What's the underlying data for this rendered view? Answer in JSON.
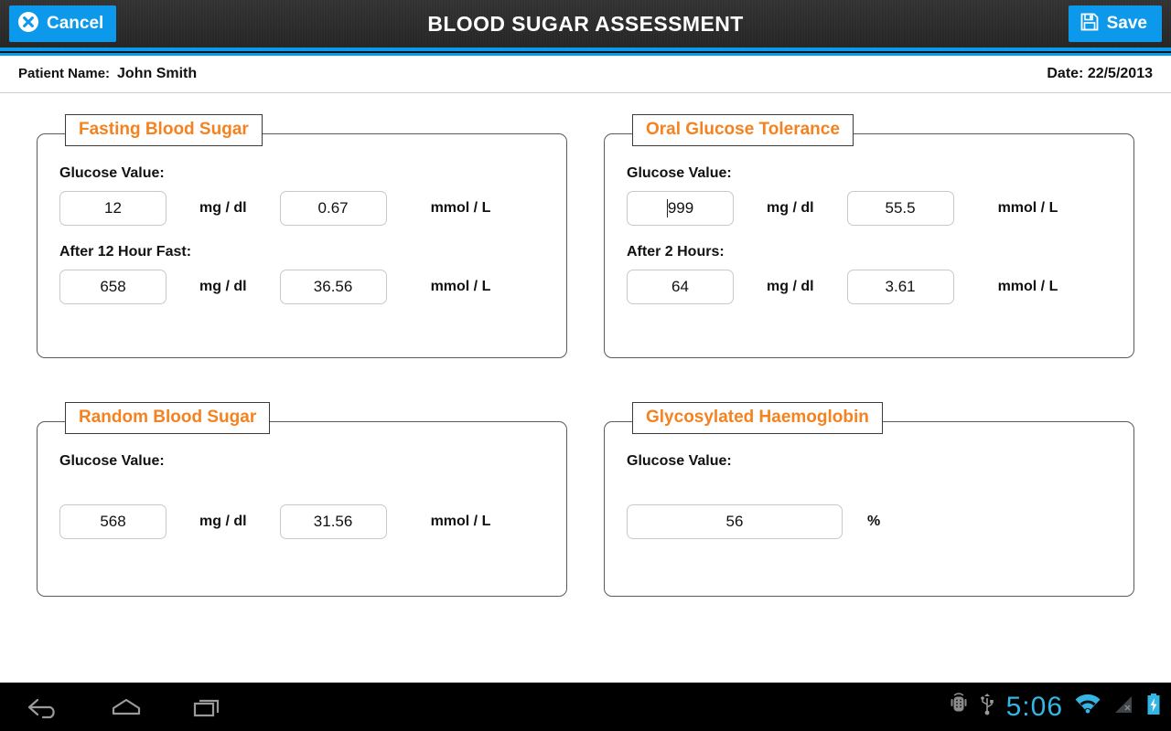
{
  "titlebar": {
    "title": "BLOOD SUGAR ASSESSMENT",
    "cancel_label": "Cancel",
    "save_label": "Save",
    "accent_color": "#0d99eb",
    "background_color": "#2d2d2d",
    "cancel_icon": "cancel-circle-x-icon",
    "save_icon": "floppy-disk-icon"
  },
  "patient_bar": {
    "name_label": "Patient Name:",
    "name_value": "John Smith",
    "date_text": "Date: 22/5/2013"
  },
  "theme": {
    "legend_color": "#f5821f",
    "panel_border": "#5a5a5a",
    "input_border": "#c9c9c9"
  },
  "panels": [
    {
      "legend": "Fasting Blood Sugar",
      "fields": [
        {
          "label": "Glucose Value:",
          "mgdl_value": "12",
          "mgdl_unit": "mg / dl",
          "mmol_value": "0.67",
          "mmol_unit": "mmol / L",
          "focused": false
        },
        {
          "label": "After 12 Hour Fast:",
          "mgdl_value": "658",
          "mgdl_unit": "mg / dl",
          "mmol_value": "36.56",
          "mmol_unit": "mmol / L",
          "focused": false
        }
      ]
    },
    {
      "legend": "Oral Glucose Tolerance",
      "fields": [
        {
          "label": "Glucose Value:",
          "mgdl_value": "999",
          "mgdl_unit": "mg / dl",
          "mmol_value": "55.5",
          "mmol_unit": "mmol / L",
          "focused": true
        },
        {
          "label": "After 2 Hours:",
          "mgdl_value": "64",
          "mgdl_unit": "mg / dl",
          "mmol_value": "3.61",
          "mmol_unit": "mmol / L",
          "focused": false
        }
      ]
    },
    {
      "legend": "Random Blood Sugar",
      "fields": [
        {
          "label": "Glucose Value:",
          "mgdl_value": "568",
          "mgdl_unit": "mg / dl",
          "mmol_value": "31.56",
          "mmol_unit": "mmol / L",
          "focused": false
        }
      ]
    },
    {
      "legend": "Glycosylated Haemoglobin",
      "fields": [
        {
          "label": "Glucose Value:",
          "percent_value": "56",
          "percent_unit": "%"
        }
      ]
    }
  ],
  "navbar": {
    "back_icon": "back-arrow-icon",
    "home_icon": "home-icon",
    "recents_icon": "recent-apps-icon",
    "adb_icon": "android-debug-icon",
    "usb_icon": "usb-icon",
    "clock": "5:06",
    "wifi_icon": "wifi-icon",
    "signal_icon": "cell-signal-no-service-icon",
    "battery_icon": "battery-charging-icon",
    "clock_color": "#33b5e5"
  }
}
